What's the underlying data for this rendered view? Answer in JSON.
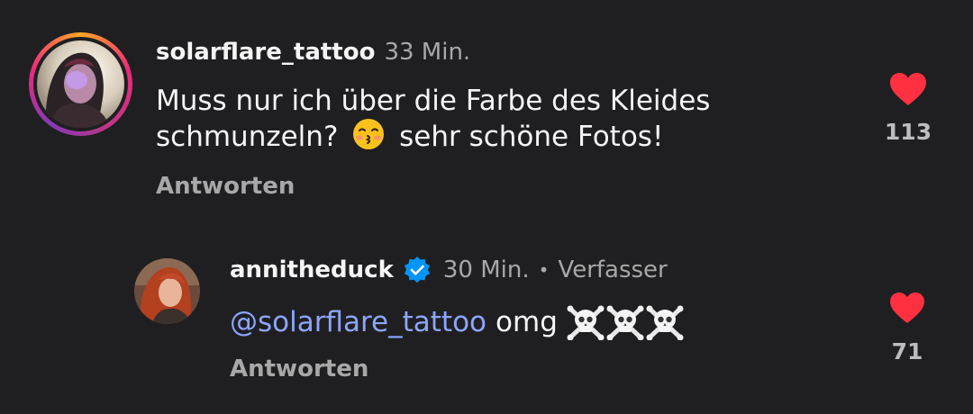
{
  "comments": [
    {
      "username": "solarflare_tattoo",
      "time": "33 Min.",
      "text_line1": "Muss nur ich über die Farbe des Kleides",
      "text_line2a": "schmunzeln?",
      "text_line2b": "sehr schöne Fotos!",
      "reply_label": "Antworten",
      "likes": "113",
      "icons": [
        "kissing-face-emoji",
        "heart-icon"
      ]
    },
    {
      "username": "annitheduck",
      "time": "30 Min.",
      "author_badge": "Verfasser",
      "mention": "@solarflare_tattoo",
      "text": "omg",
      "reply_label": "Antworten",
      "likes": "71",
      "icons": [
        "verified-badge-icon",
        "skull-crossbones-emoji",
        "heart-icon"
      ]
    }
  ],
  "colors": {
    "background": "#1f1f21",
    "like_red": "#ff3040",
    "mention_blue": "#8da5ff",
    "verified_blue": "#0095f6"
  }
}
